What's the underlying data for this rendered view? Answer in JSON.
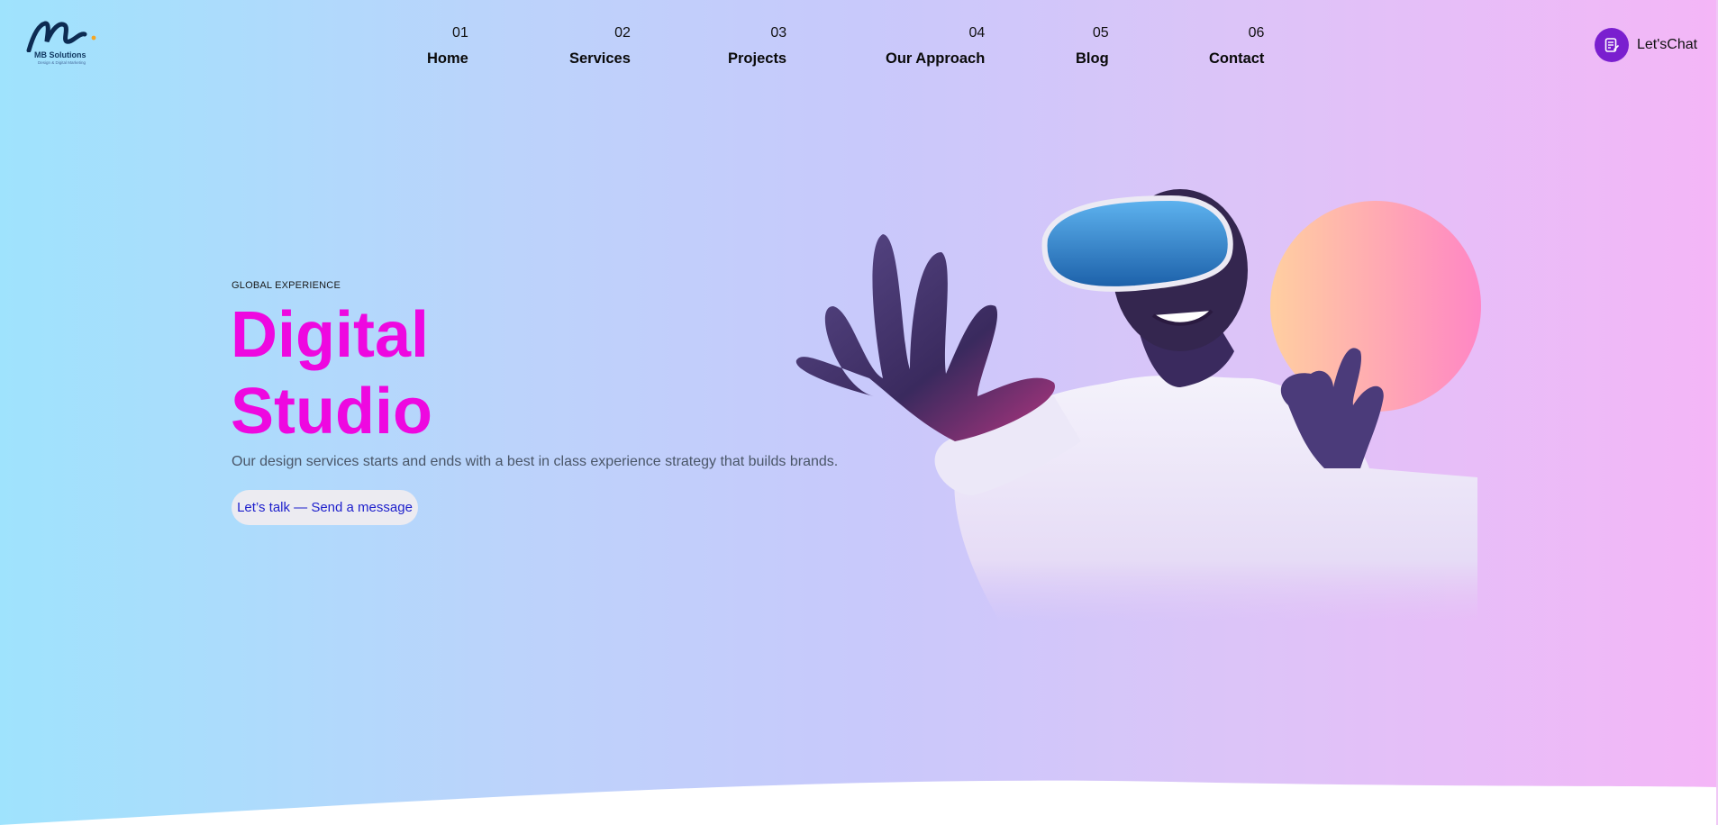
{
  "brand": {
    "name": "MB Solutions",
    "tagline": "Design & Digital Marketing"
  },
  "nav": [
    {
      "num": "01",
      "label": "Home"
    },
    {
      "num": "02",
      "label": "Services"
    },
    {
      "num": "03",
      "label": "Projects"
    },
    {
      "num": "04",
      "label": "Our Approach"
    },
    {
      "num": "05",
      "label": "Blog"
    },
    {
      "num": "06",
      "label": "Contact"
    }
  ],
  "chat": {
    "label": "Let'sChat",
    "icon": "chat-form-icon"
  },
  "hero": {
    "eyebrow": "GLOBAL EXPERIENCE",
    "title_line1": "Digital",
    "title_line2": "Studio",
    "description": "Our design services starts and ends with a best in class experience strategy that builds brands.",
    "cta_label": "Let’s talk — Send a message",
    "image": "vr-headset-person-illustration"
  },
  "colors": {
    "accent": "#ee08e0",
    "chat_button": "#7a1fcf",
    "cta_text": "#1d1fcc",
    "gradient_start": "#9fe3fd",
    "gradient_end": "#f4b6f7"
  }
}
